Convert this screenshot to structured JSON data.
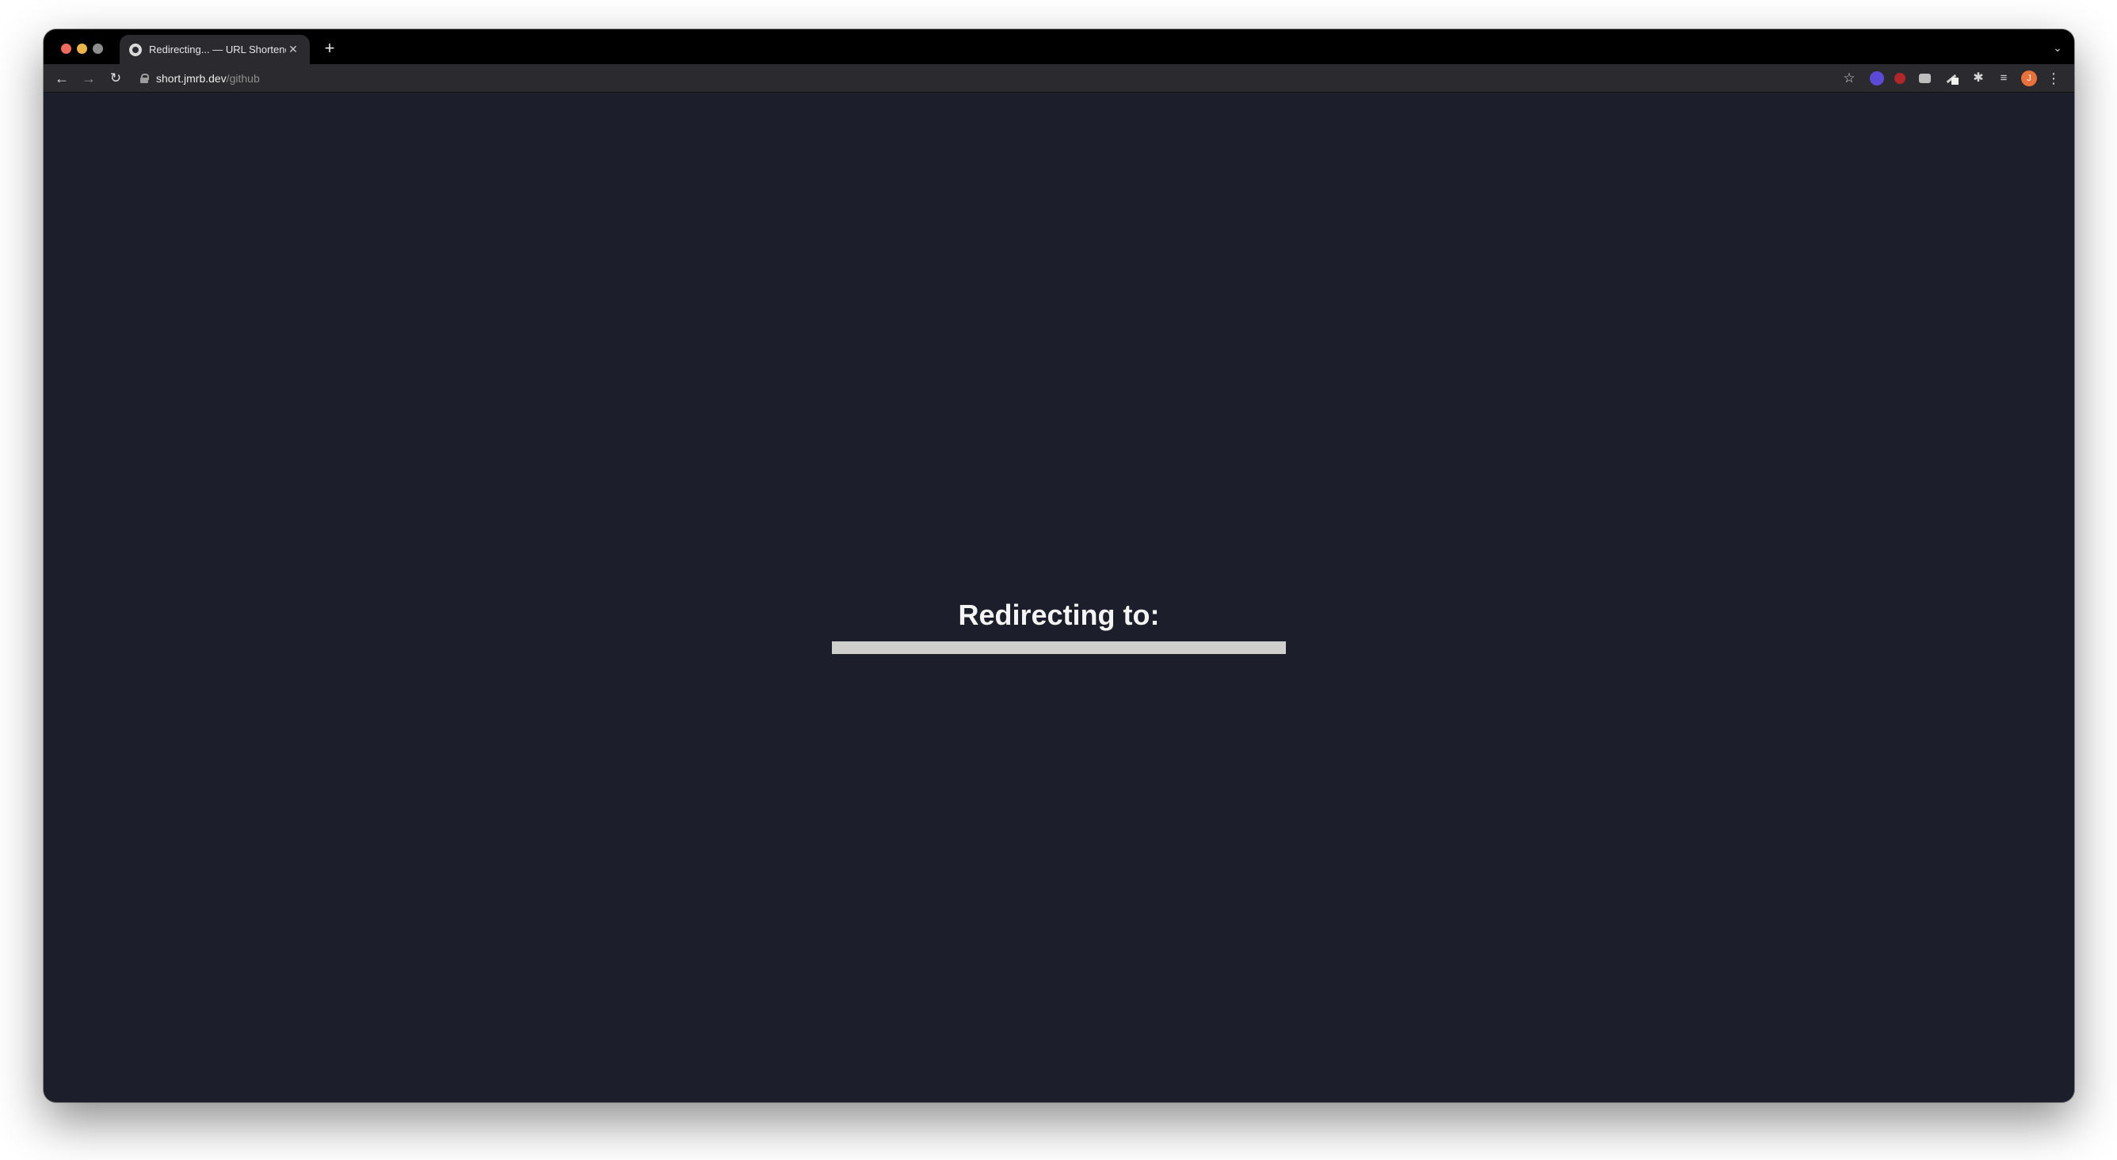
{
  "browser": {
    "tab": {
      "title": "Redirecting... — URL Shortener",
      "close_glyph": "✕"
    },
    "new_tab_glyph": "+",
    "tab_search_glyph": "⌄",
    "nav": {
      "back_glyph": "←",
      "forward_glyph": "→",
      "reload_glyph": "↻"
    },
    "address": {
      "host": "short.jmrb.dev",
      "path": "/github"
    },
    "bookmark_glyph": "☆",
    "extensions_glyph": "✱",
    "media_glyph": "≡",
    "avatar_initial": "J",
    "menu_glyph": "⋮",
    "icons": [
      "lock-icon",
      "star-icon",
      "puzzle-icon",
      "media-control-icon",
      "avatar",
      "kebab-menu-icon"
    ]
  },
  "page": {
    "heading": "Redirecting to:",
    "target_bar_color": "#cfd0cd",
    "background_color": "#1c1f2b"
  }
}
